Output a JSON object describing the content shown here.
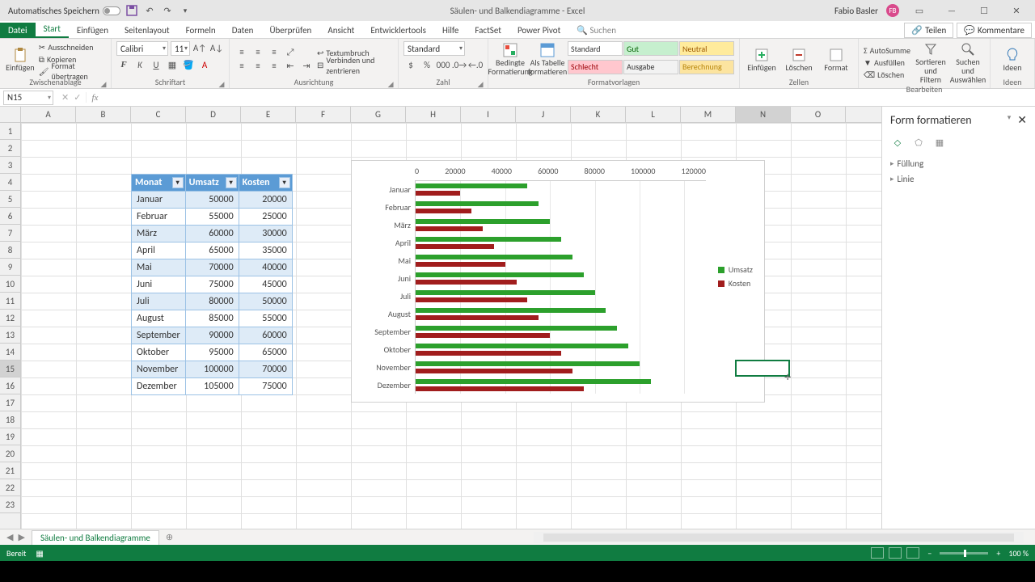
{
  "titlebar": {
    "autosave": "Automatisches Speichern",
    "doc_title": "Säulen- und Balkendiagramme - Excel",
    "user": "Fabio Basler",
    "user_initials": "FB"
  },
  "tabs": {
    "file": "Datei",
    "items": [
      "Start",
      "Einfügen",
      "Seitenlayout",
      "Formeln",
      "Daten",
      "Überprüfen",
      "Ansicht",
      "Entwicklertools",
      "Hilfe",
      "FactSet",
      "Power Pivot"
    ],
    "active": "Start",
    "search_placeholder": "Suchen",
    "share": "Teilen",
    "comments": "Kommentare"
  },
  "ribbon": {
    "paste": "Einfügen",
    "cut": "Ausschneiden",
    "copy": "Kopieren",
    "format_painter": "Format übertragen",
    "clipboard_group": "Zwischenablage",
    "font_name": "Calibri",
    "font_size": "11",
    "font_group": "Schriftart",
    "wrap": "Textumbruch",
    "merge": "Verbinden und zentrieren",
    "align_group": "Ausrichtung",
    "number_format": "Standard",
    "number_group": "Zahl",
    "cond_format": "Bedingte Formatierung",
    "as_table": "Als Tabelle formatieren",
    "styles": {
      "standard": "Standard",
      "gut": "Gut",
      "neutral": "Neutral",
      "schlecht": "Schlecht",
      "ausgabe": "Ausgabe",
      "berechnung": "Berechnung"
    },
    "styles_group": "Formatvorlagen",
    "insert": "Einfügen",
    "delete": "Löschen",
    "format": "Format",
    "cells_group": "Zellen",
    "autosum": "AutoSumme",
    "fill": "Ausfüllen",
    "clear": "Löschen",
    "sort": "Sortieren und Filtern",
    "find": "Suchen und Auswählen",
    "edit_group": "Bearbeiten",
    "ideas": "Ideen",
    "ideas_group": "Ideen"
  },
  "name_box": "N15",
  "columns": [
    "A",
    "B",
    "C",
    "D",
    "E",
    "F",
    "G",
    "H",
    "I",
    "J",
    "K",
    "L",
    "M",
    "N",
    "O"
  ],
  "side_pane": {
    "title": "Form formatieren",
    "fill": "Füllung",
    "line": "Linie"
  },
  "sheet_tab": "Säulen- und Balkendiagramme",
  "status": {
    "ready": "Bereit",
    "zoom": "100 %"
  },
  "chart_data": {
    "type": "bar",
    "orientation": "horizontal",
    "categories": [
      "Januar",
      "Februar",
      "März",
      "April",
      "Mai",
      "Juni",
      "Juli",
      "August",
      "September",
      "Oktober",
      "November",
      "Dezember"
    ],
    "series": [
      {
        "name": "Umsatz",
        "color": "#2ca02c",
        "values": [
          50000,
          55000,
          60000,
          65000,
          70000,
          75000,
          80000,
          85000,
          90000,
          95000,
          100000,
          105000
        ]
      },
      {
        "name": "Kosten",
        "color": "#a11d1d",
        "values": [
          20000,
          25000,
          30000,
          35000,
          40000,
          45000,
          50000,
          55000,
          60000,
          65000,
          70000,
          75000
        ]
      }
    ],
    "x_ticks": [
      0,
      20000,
      40000,
      60000,
      80000,
      100000,
      120000
    ],
    "xlim": [
      0,
      130000
    ],
    "legend_position": "right"
  },
  "table": {
    "headers": [
      "Monat",
      "Umsatz",
      "Kosten"
    ],
    "rows": [
      [
        "Januar",
        50000,
        20000
      ],
      [
        "Februar",
        55000,
        25000
      ],
      [
        "März",
        60000,
        30000
      ],
      [
        "April",
        65000,
        35000
      ],
      [
        "Mai",
        70000,
        40000
      ],
      [
        "Juni",
        75000,
        45000
      ],
      [
        "Juli",
        80000,
        50000
      ],
      [
        "August",
        85000,
        55000
      ],
      [
        "September",
        90000,
        60000
      ],
      [
        "Oktober",
        95000,
        65000
      ],
      [
        "November",
        100000,
        70000
      ],
      [
        "Dezember",
        105000,
        75000
      ]
    ]
  }
}
